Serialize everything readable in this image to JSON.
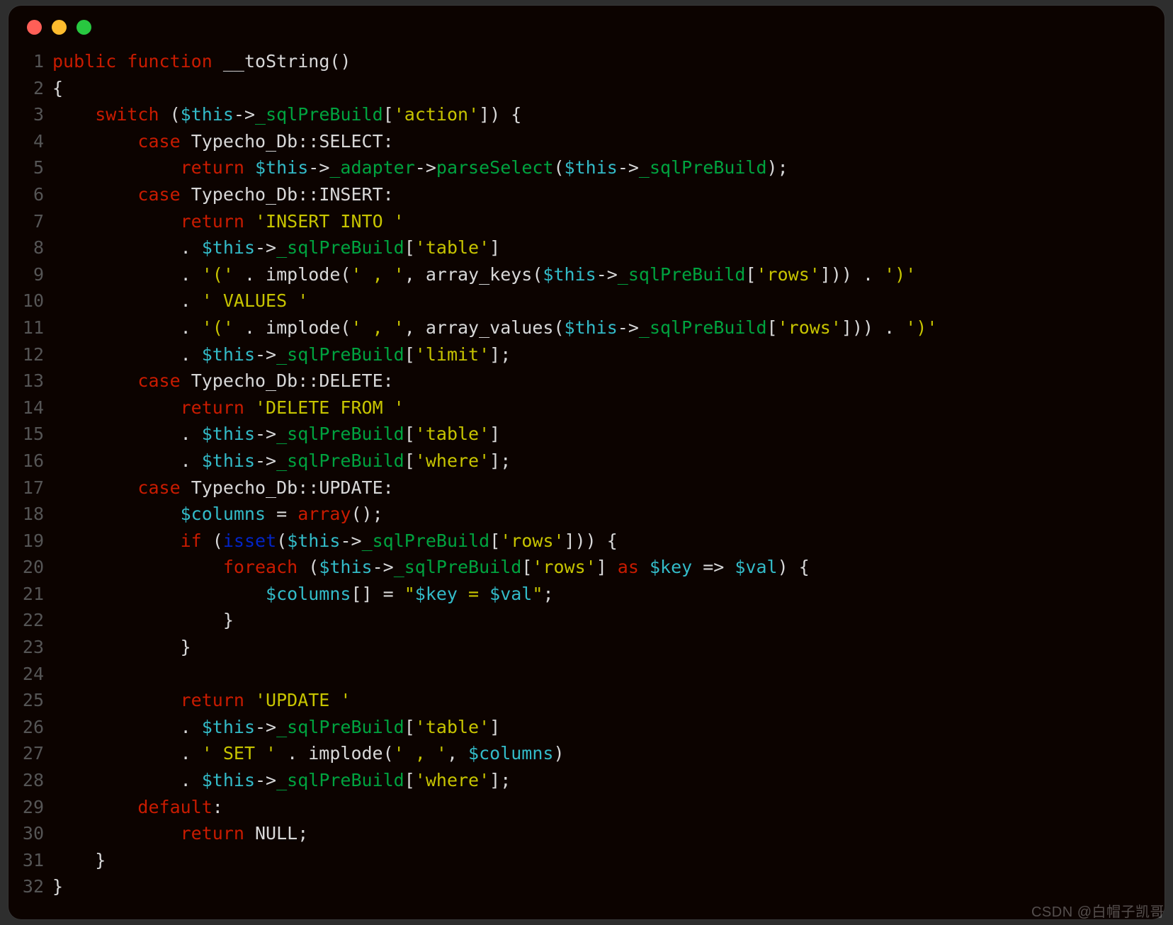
{
  "window": {
    "traffic_lights": [
      "close",
      "minimize",
      "zoom"
    ]
  },
  "watermark": "CSDN @白帽子凯哥",
  "line_count": 32,
  "code_tokens": {
    "keywords": {
      "public": "public",
      "function": "function",
      "switch": "switch",
      "case": "case",
      "return": "return",
      "if": "if",
      "isset": "isset",
      "foreach": "foreach",
      "as": "as",
      "default": "default",
      "array": "array"
    },
    "identifiers": {
      "toString": "__toString",
      "this": "$this",
      "sqlPreBuild": "_sqlPreBuild",
      "adapter": "_adapter",
      "parseSelect": "parseSelect",
      "TypechoDb": "Typecho_Db",
      "SELECT": "SELECT",
      "INSERT": "INSERT",
      "DELETE": "DELETE",
      "UPDATE": "UPDATE",
      "columns": "$columns",
      "key": "$key",
      "val": "$val",
      "implode": "implode",
      "array_keys": "array_keys",
      "array_values": "array_values",
      "NULL": "NULL"
    },
    "strings": {
      "action": "'action'",
      "insert_into": "'INSERT INTO '",
      "table": "'table'",
      "lparen": "'('",
      "comma_sep": "' , '",
      "rows": "'rows'",
      "rparen": "')'",
      "values": "' VALUES '",
      "limit": "'limit'",
      "delete_from": "'DELETE FROM '",
      "where": "'where'",
      "update": "'UPDATE '",
      "set": "' SET '",
      "interp": "\"$key = $val\""
    }
  }
}
